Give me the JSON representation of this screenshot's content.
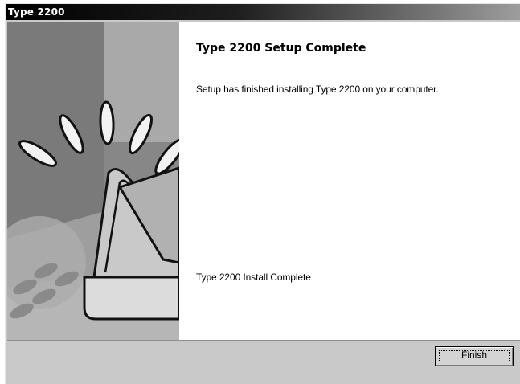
{
  "window": {
    "title": "Type 2200"
  },
  "banner": {
    "icon": "product-install-illustration",
    "colors": {
      "dark": "#5a5a5a",
      "mid": "#9a9a9a",
      "light": "#d8d8d8"
    }
  },
  "content": {
    "heading": "Type 2200 Setup Complete",
    "message": "Setup has finished installing Type 2200 on your computer.",
    "status": "Type 2200 Install Complete"
  },
  "footer": {
    "finish_label": "Finish"
  }
}
